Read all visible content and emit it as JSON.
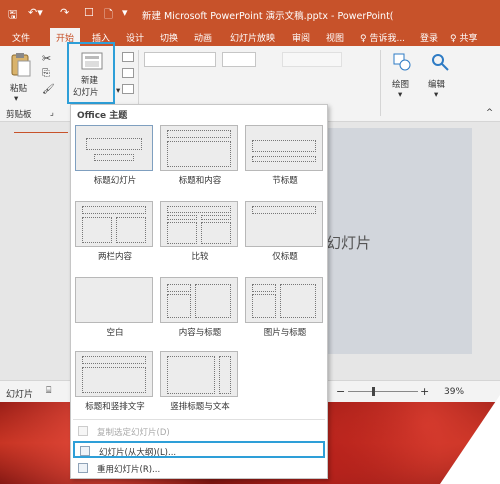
{
  "titlebar": {
    "title": "新建 Microsoft PowerPoint 演示文稿.pptx - PowerPoint(",
    "save_icon": "save-icon",
    "undo_icon": "undo-icon",
    "redo_icon": "redo-icon",
    "bg_color": "#c7522a"
  },
  "tabs": [
    {
      "label": "文件"
    },
    {
      "label": "开始"
    },
    {
      "label": "插入"
    },
    {
      "label": "设计"
    },
    {
      "label": "切换"
    },
    {
      "label": "动画"
    },
    {
      "label": "幻灯片放映"
    },
    {
      "label": "审阅"
    },
    {
      "label": "视图"
    },
    {
      "label": "♀ 告诉我..."
    },
    {
      "label": "登录"
    },
    {
      "label": "♀ 共享"
    }
  ],
  "ribbon": {
    "paste_label": "粘贴",
    "new_slide_label_line1": "新建",
    "new_slide_label_line2": "幻灯片",
    "clipboard_group": "剪贴板",
    "draw_label": "绘图",
    "edit_label": "编辑"
  },
  "gallery": {
    "header": "Office 主题",
    "layouts": [
      {
        "name": "标题幻灯片"
      },
      {
        "name": "标题和内容"
      },
      {
        "name": "节标题"
      },
      {
        "name": "两栏内容"
      },
      {
        "name": "比较"
      },
      {
        "name": "仅标题"
      },
      {
        "name": "空白"
      },
      {
        "name": "内容与标题"
      },
      {
        "name": "图片与标题"
      },
      {
        "name": "标题和竖排文字"
      },
      {
        "name": "竖排标题与文本"
      }
    ],
    "menu": [
      {
        "label": "复制选定幻灯片(D)",
        "enabled": false
      },
      {
        "label": "幻灯片(从大纲)(L)...",
        "enabled": true
      },
      {
        "label": "重用幻灯片(R)...",
        "enabled": true
      }
    ]
  },
  "slide": {
    "placeholder": "幻灯片"
  },
  "statusbar": {
    "left": "幻灯片",
    "zoom_minus": "−",
    "zoom_plus": "+",
    "zoom": "39%"
  },
  "colors": {
    "accent": "#c7522a",
    "highlight_border": "#2e9fd8"
  }
}
